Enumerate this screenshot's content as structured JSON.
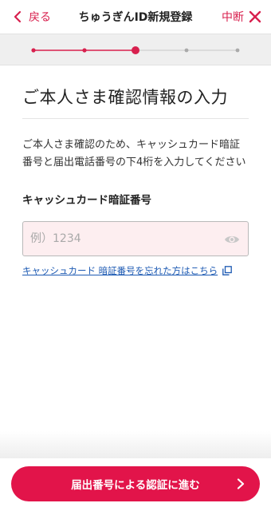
{
  "header": {
    "back_label": "戻る",
    "title": "ちゅうぎんID新規登録",
    "quit_label": "中断"
  },
  "stepper": {
    "total_steps": 5,
    "current_step": 3,
    "active_color": "#d8204e",
    "inactive_color": "#aaaaaa"
  },
  "main": {
    "heading": "ご本人さま確認情報の入力",
    "description": "ご本人さま確認のため、キャッシュカード暗証番号と届出電話番号の下4桁を入力してください",
    "field_label": "キャッシュカード暗証番号",
    "input_placeholder": "例）1234",
    "input_value": "",
    "forgot_link": "キャッシュカード 暗証番号を忘れた方はこちら"
  },
  "footer": {
    "cta_label": "届出番号による認証に進む"
  },
  "colors": {
    "accent": "#e2144a",
    "link": "#1d5ab3",
    "input_bg": "#fdeef0"
  },
  "icons": [
    "chevron-left-icon",
    "close-icon",
    "eye-icon",
    "external-link-icon",
    "chevron-right-icon"
  ]
}
